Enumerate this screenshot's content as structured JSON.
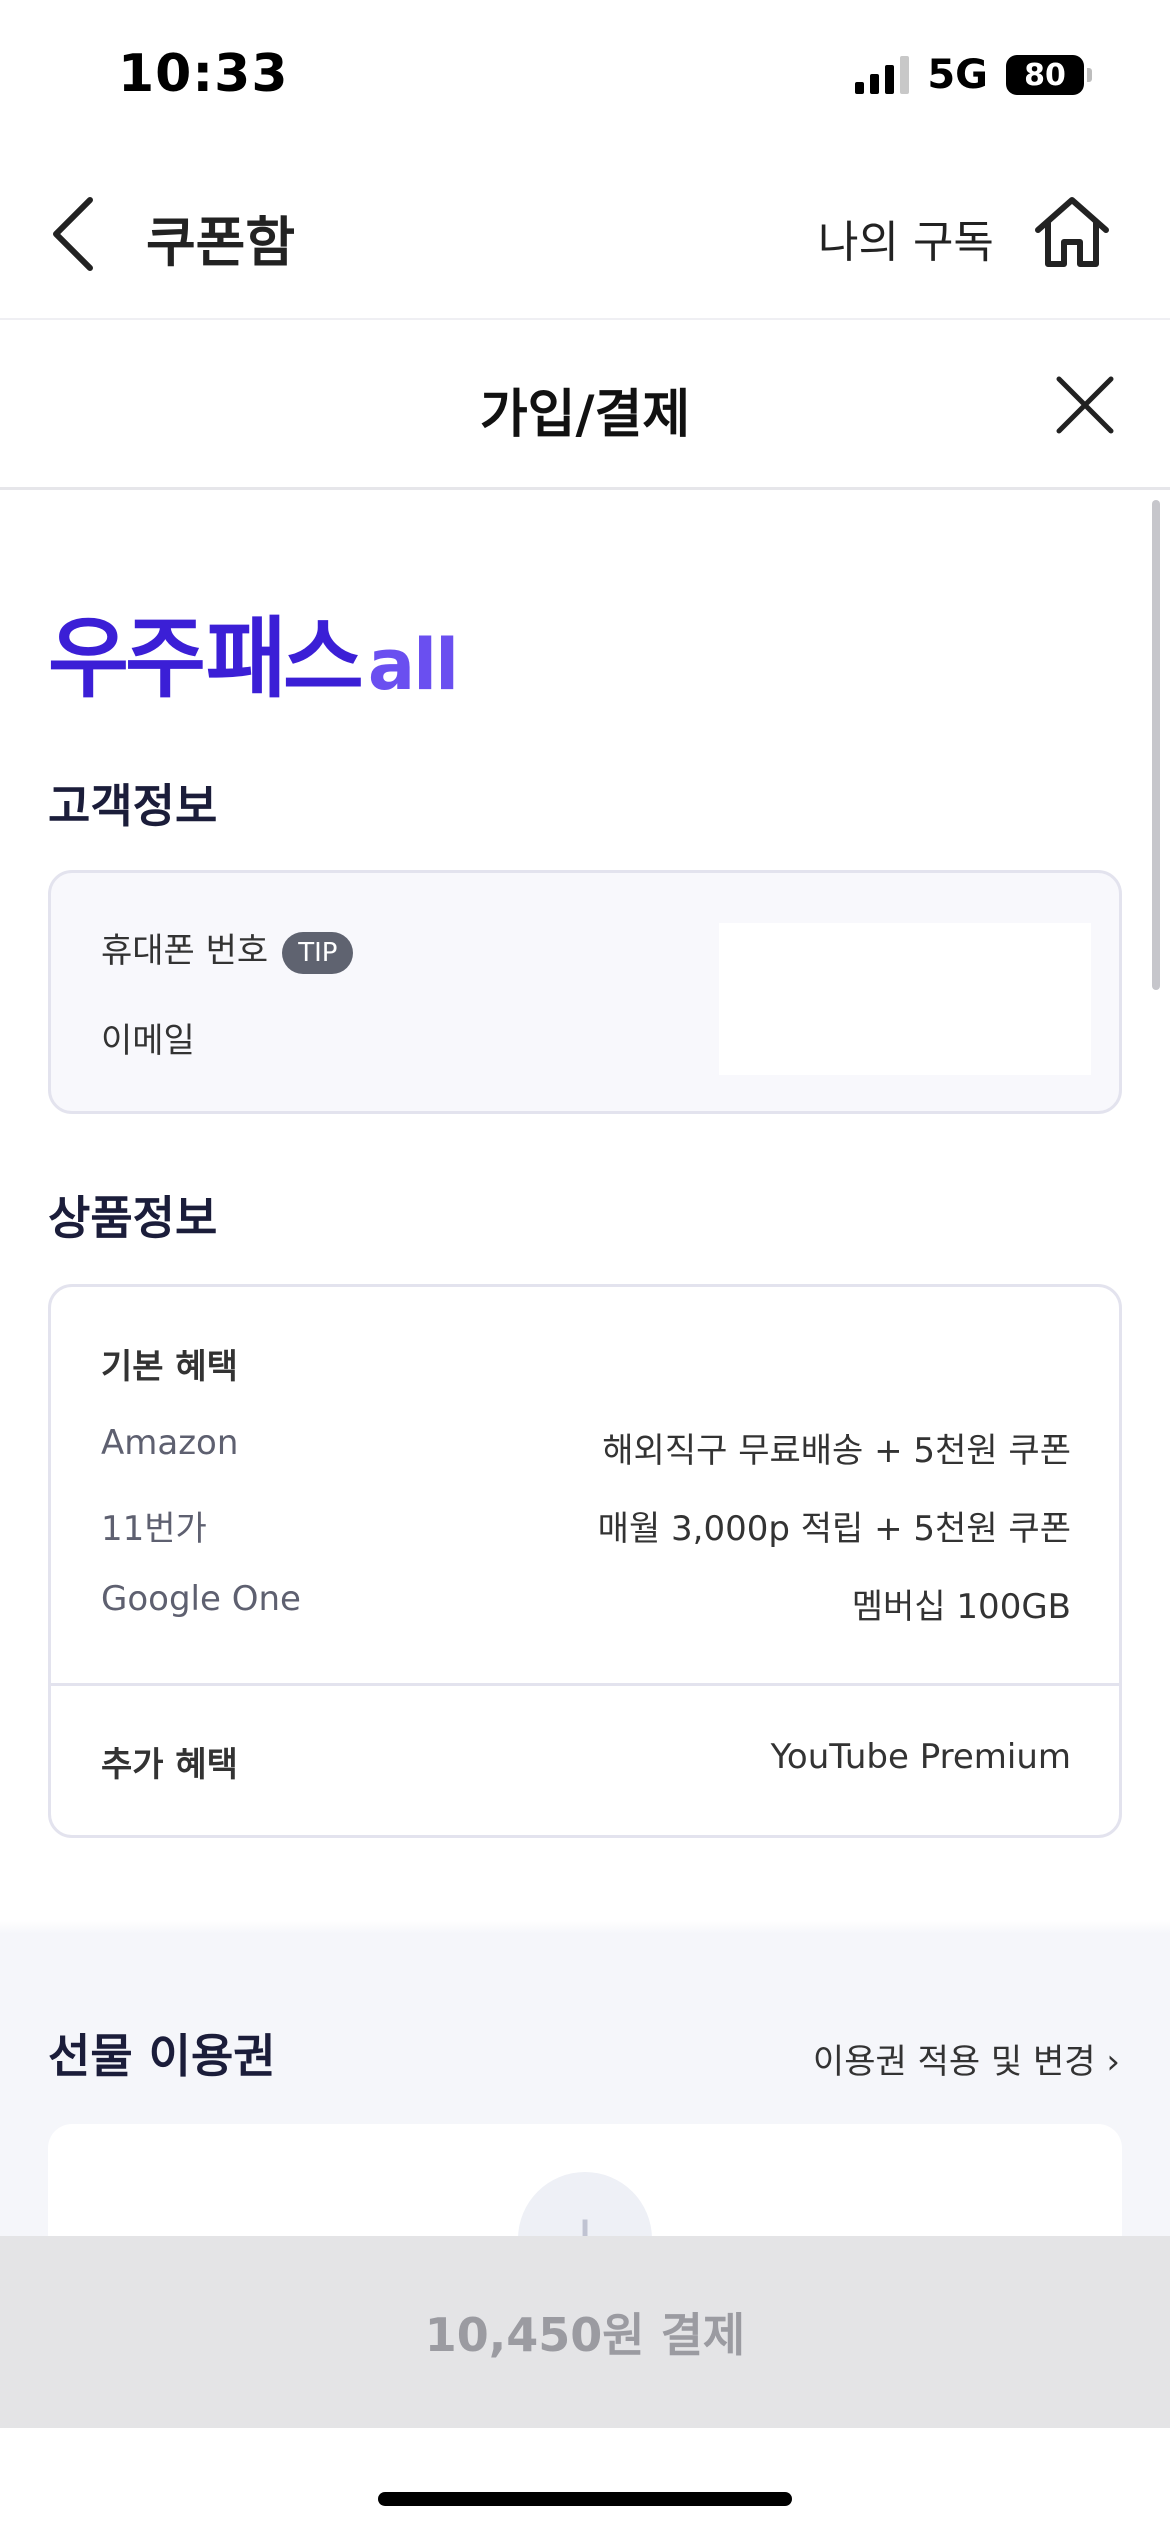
{
  "status_bar": {
    "time": "10:33",
    "network": "5G",
    "battery": "80"
  },
  "header": {
    "title": "쿠폰함",
    "my_subscription": "나의 구독",
    "back_icon": "chevron-left-icon",
    "home_icon": "home-icon"
  },
  "modal": {
    "title": "가입/결제",
    "close_icon": "close-icon"
  },
  "logo": {
    "main": "우주",
    "sub": "패스",
    "suffix": "all",
    "color": "#3b1fd6"
  },
  "customer": {
    "section_title": "고객정보",
    "phone_label": "휴대폰 번호",
    "tip_badge": "TIP",
    "email_label": "이메일"
  },
  "product": {
    "section_title": "상품정보",
    "basic_title": "기본 혜택",
    "rows": [
      {
        "label": "Amazon",
        "value": "해외직구 무료배송 + 5천원 쿠폰"
      },
      {
        "label": "11번가",
        "value": "매월 3,000p 적립 + 5천원 쿠폰"
      },
      {
        "label": "Google One",
        "value": "멤버십 100GB"
      }
    ],
    "extra_title": "추가 혜택",
    "extra_value": "YouTube Premium"
  },
  "gift": {
    "section_title": "선물 이용권",
    "link": "이용권 적용 및 변경 ›",
    "add_icon": "plus-icon"
  },
  "pay": {
    "label": "10,450원 결제"
  }
}
